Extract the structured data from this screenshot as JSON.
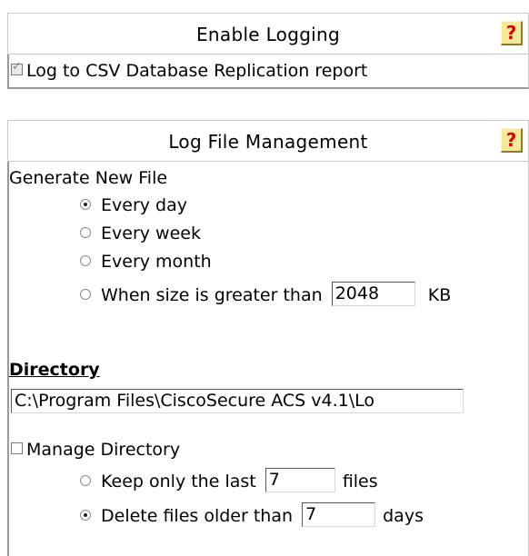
{
  "enable_logging": {
    "title": "Enable Logging",
    "help_icon": "?",
    "log_to_csv_label": "Log to CSV Database Replication report",
    "log_to_csv_checked": true
  },
  "log_file_management": {
    "title": "Log File Management",
    "help_icon": "?",
    "generate_new_file_label": "Generate New File",
    "options": [
      {
        "label": "Every day",
        "checked": true
      },
      {
        "label": "Every week",
        "checked": false
      },
      {
        "label": "Every month",
        "checked": false
      },
      {
        "label": "When size is greater than",
        "checked": false
      }
    ],
    "size_value": "2048",
    "size_unit": "KB",
    "directory_label": "Directory",
    "directory_value": "C:\\Program Files\\CiscoSecure ACS v4.1\\Lo",
    "manage_directory_label": "Manage Directory",
    "manage_directory_checked": false,
    "keep_last_label": "Keep only the last",
    "keep_last_value": "7",
    "keep_last_unit": "files",
    "keep_last_checked": false,
    "delete_older_label": "Delete files older than",
    "delete_older_value": "7",
    "delete_older_unit": "days",
    "delete_older_checked": true
  },
  "icons": {
    "help": "help-question-icon",
    "checkbox": "checkbox-icon",
    "radio": "radio-icon"
  }
}
